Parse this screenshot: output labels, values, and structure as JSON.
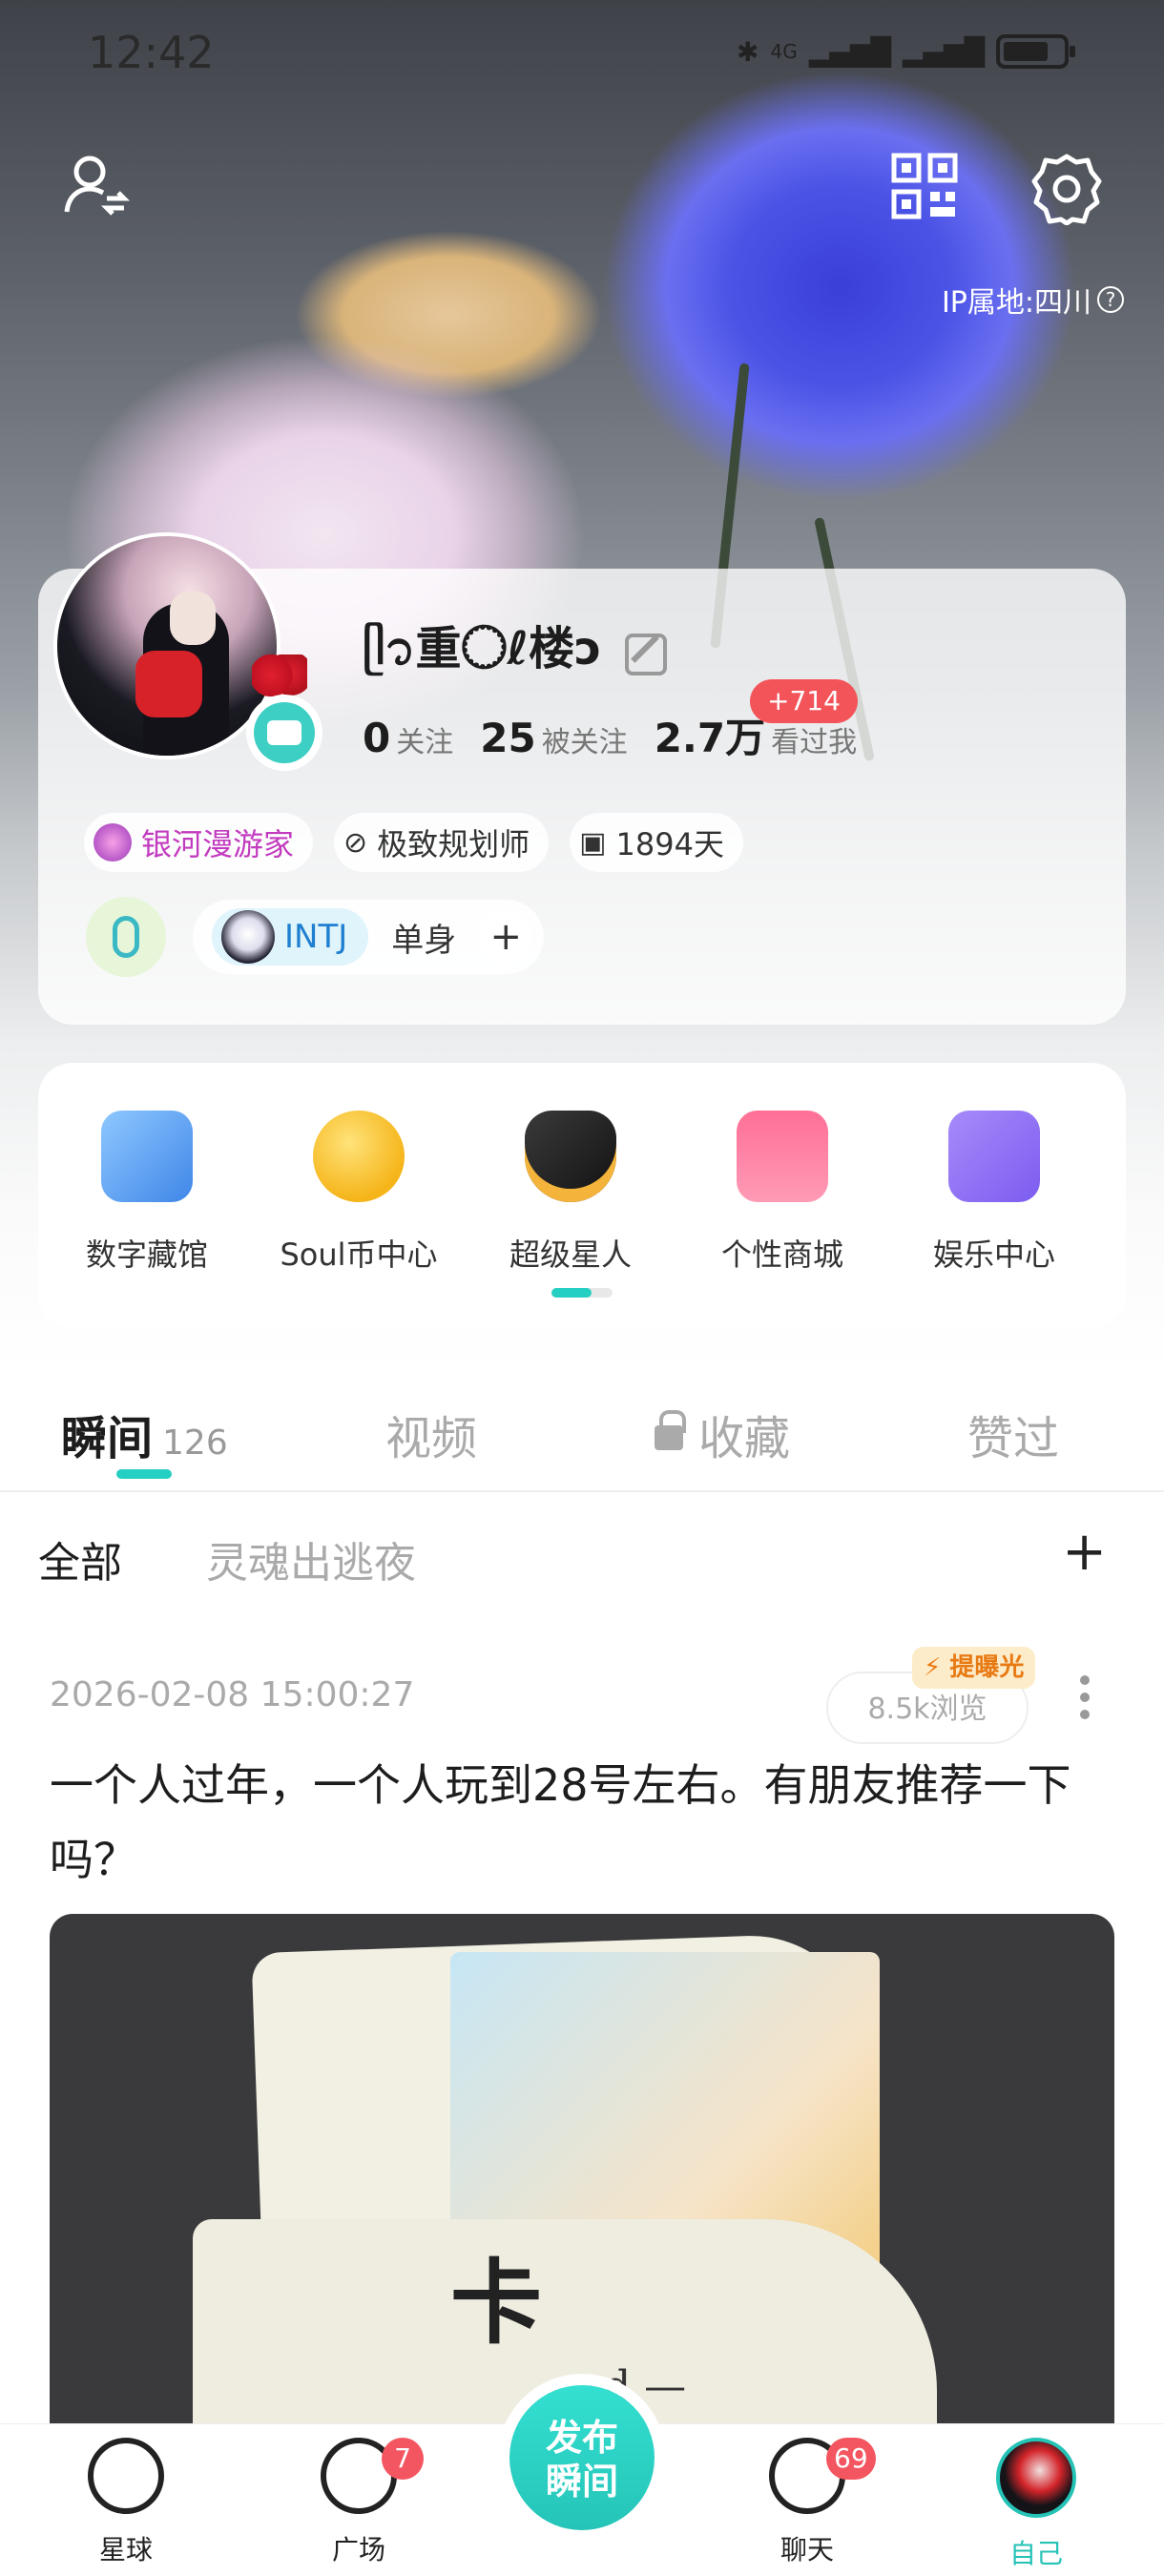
{
  "status_bar": {
    "time": "12:42",
    "network": "4G"
  },
  "header": {
    "ip_location": "IP属地:四川",
    "ip_info_glyph": "?"
  },
  "profile": {
    "nickname": "ᥫ᭡重◌⃝ℓ楼ↄ",
    "stats": [
      {
        "value": "0",
        "label": "关注"
      },
      {
        "value": "25",
        "label": "被关注"
      },
      {
        "value": "2.7万",
        "label": "看过我"
      }
    ],
    "new_visitors_badge": "+714",
    "tags": [
      {
        "label": "银河漫游家"
      },
      {
        "label": "极致规划师"
      },
      {
        "label": "1894天"
      }
    ],
    "mbti": "INTJ",
    "relationship": "单身",
    "add_tag": "+"
  },
  "services": [
    {
      "label": "数字藏馆"
    },
    {
      "label": "Soul币中心"
    },
    {
      "label": "超级星人"
    },
    {
      "label": "个性商城"
    },
    {
      "label": "娱乐中心"
    }
  ],
  "content_tabs": [
    {
      "label": "瞬间",
      "count": "126",
      "active": true
    },
    {
      "label": "视频"
    },
    {
      "label": "收藏",
      "locked": true
    },
    {
      "label": "赞过"
    }
  ],
  "filters": {
    "items": [
      "全部",
      "灵魂出逃夜"
    ],
    "add": "+"
  },
  "post": {
    "time": "2026-02-08 15:00:27",
    "boost_label": "提曝光",
    "views": "8.5k浏览",
    "text": "一个人过年，一个人玩到28号左右。有朋友推荐一下吗？",
    "image_card_text": "卡",
    "image_card_sub": "rd —"
  },
  "bottom_nav": {
    "items": [
      {
        "label": "星球"
      },
      {
        "label": "广场",
        "badge": "7"
      },
      {
        "label": "聊天",
        "badge": "69"
      },
      {
        "label": "自己",
        "active": true
      }
    ],
    "publish_label_1": "发布",
    "publish_label_2": "瞬间"
  },
  "colors": {
    "accent": "#25d0c2",
    "badge_red": "#f3545a",
    "tag_purple": "#c23bbf",
    "mbti_blue": "#1f7fd0"
  }
}
